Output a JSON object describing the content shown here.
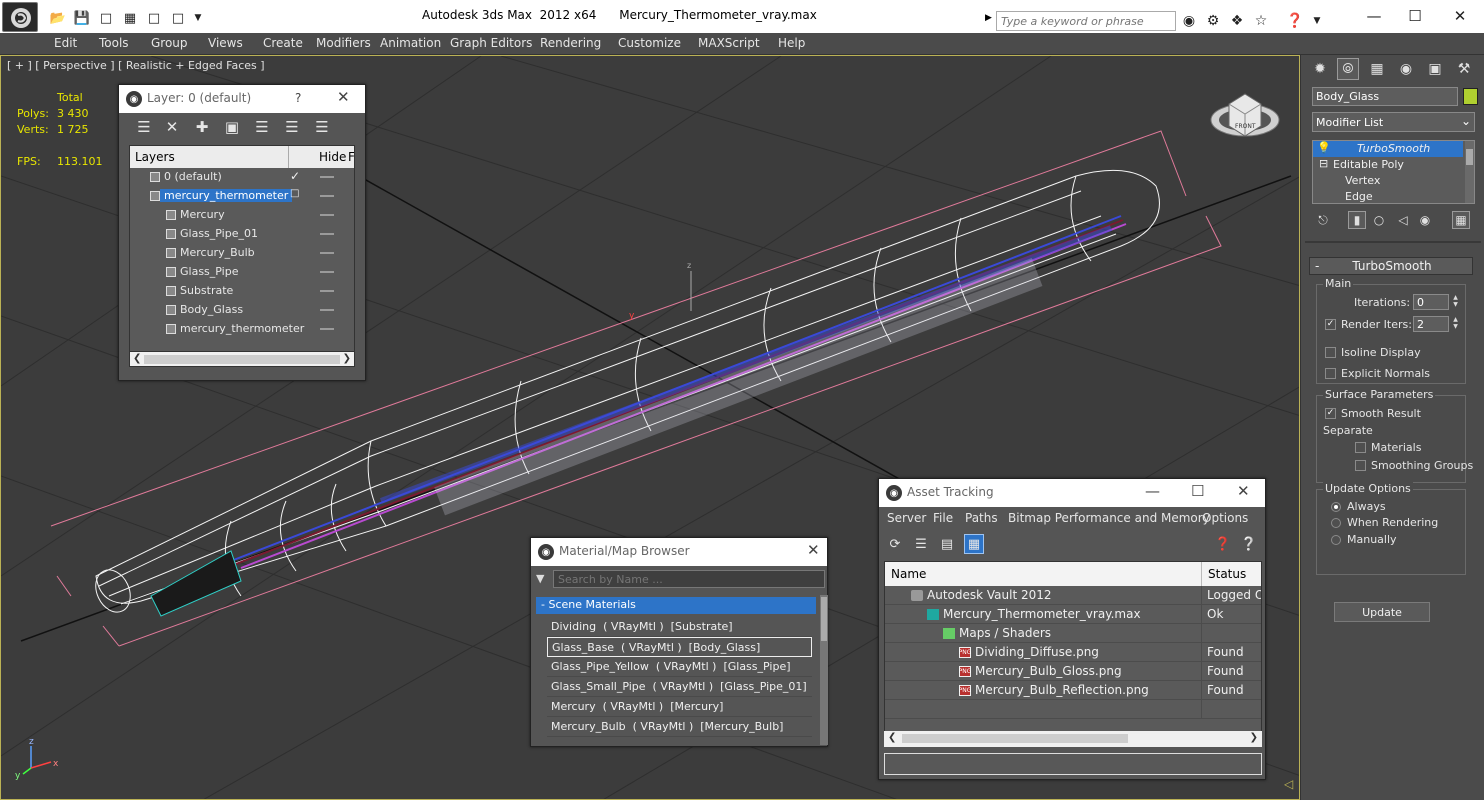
{
  "app": {
    "window_title": "Autodesk 3ds Max  2012 x64      Mercury_Thermometer_vray.max",
    "search_placeholder": "Type a keyword or phrase"
  },
  "menu": [
    "Edit",
    "Tools",
    "Group",
    "Views",
    "Create",
    "Modifiers",
    "Animation",
    "Graph Editors",
    "Rendering",
    "Customize",
    "MAXScript",
    "Help"
  ],
  "viewport": {
    "label": "[ + ] [ Perspective ] [ Realistic + Edged Faces ]",
    "stats": {
      "total_label": "Total",
      "polys_label": "Polys:",
      "polys": "3 430",
      "verts_label": "Verts:",
      "verts": "1 725",
      "fps_label": "FPS:",
      "fps": "113.101"
    },
    "cube_label": "FRONT",
    "axis": {
      "x": "x",
      "y": "y",
      "z": "z"
    }
  },
  "layer_window": {
    "title": "Layer: 0 (default)",
    "help": "?",
    "col_layers": "Layers",
    "col_hide": "Hide",
    "col_f": "F",
    "rows": [
      {
        "name": "0 (default)"
      },
      {
        "name": "mercury_thermometer"
      },
      {
        "name": "Mercury"
      },
      {
        "name": "Glass_Pipe_01"
      },
      {
        "name": "Mercury_Bulb"
      },
      {
        "name": "Glass_Pipe"
      },
      {
        "name": "Substrate"
      },
      {
        "name": "Body_Glass"
      },
      {
        "name": "mercury_thermometer"
      }
    ]
  },
  "material_browser": {
    "title": "Material/Map Browser",
    "search_placeholder": "Search by Name ...",
    "group": "- Scene Materials",
    "items": [
      "Dividing  ( VRayMtl )  [Substrate]",
      "Glass_Base  ( VRayMtl )  [Body_Glass]",
      "Glass_Pipe_Yellow  ( VRayMtl )  [Glass_Pipe]",
      "Glass_Small_Pipe  ( VRayMtl )  [Glass_Pipe_01]",
      "Mercury  ( VRayMtl )  [Mercury]",
      "Mercury_Bulb  ( VRayMtl )  [Mercury_Bulb]"
    ]
  },
  "asset_tracking": {
    "title": "Asset Tracking",
    "menu": [
      "Server",
      "File",
      "Paths",
      "Bitmap Performance and Memory",
      "Options"
    ],
    "col_name": "Name",
    "col_status": "Status",
    "rows": [
      {
        "name": "Autodesk Vault 2012",
        "status": "Logged Out",
        "icon": "vault-icon"
      },
      {
        "name": "Mercury_Thermometer_vray.max",
        "status": "Ok",
        "icon": "max-file-icon"
      },
      {
        "name": "Maps / Shaders",
        "status": "",
        "icon": "maps-folder-icon"
      },
      {
        "name": "Dividing_Diffuse.png",
        "status": "Found",
        "icon": "png-file-icon"
      },
      {
        "name": "Mercury_Bulb_Gloss.png",
        "status": "Found",
        "icon": "png-file-icon"
      },
      {
        "name": "Mercury_Bulb_Reflection.png",
        "status": "Found",
        "icon": "png-file-icon"
      }
    ],
    "png_badge": "PNG"
  },
  "command_panel": {
    "object_name": "Body_Glass",
    "object_color": "#b0d030",
    "modifier_list": "Modifier List",
    "stack": [
      "TurboSmooth",
      "Editable Poly",
      "Vertex",
      "Edge"
    ],
    "rollout_title": "TurboSmooth",
    "main": {
      "title": "Main",
      "iterations_label": "Iterations:",
      "iterations": "0",
      "render_iters_label": "Render Iters:",
      "render_iters": "2",
      "render_iters_checked": true,
      "isoline_label": "Isoline Display",
      "isoline_checked": false,
      "explicit_label": "Explicit Normals",
      "explicit_checked": false
    },
    "surface": {
      "title": "Surface Parameters",
      "smooth_result_label": "Smooth Result",
      "smooth_result_checked": true,
      "separate_label": "Separate",
      "materials_label": "Materials",
      "materials_checked": false,
      "smoothing_groups_label": "Smoothing Groups",
      "smoothing_groups_checked": false
    },
    "update": {
      "title": "Update Options",
      "always_label": "Always",
      "always_selected": true,
      "when_rendering_label": "When Rendering",
      "manually_label": "Manually",
      "update_button": "Update"
    }
  },
  "colors": {
    "selection_blue": "#2d74c8",
    "viewport_border": "#bbb255",
    "stats_yellow": "#e8e600"
  }
}
